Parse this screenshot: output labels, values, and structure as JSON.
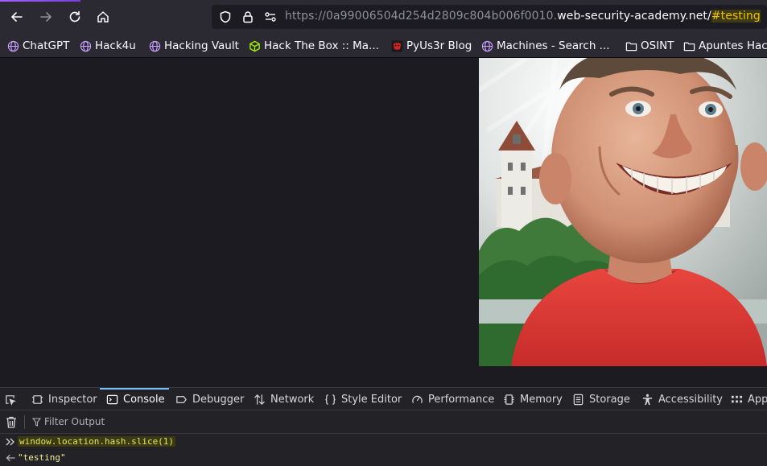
{
  "browser": {
    "url": {
      "prefix": "https://0a99006504d254d2809c804b006f0010.",
      "domain": "web-security-academy.net/",
      "hash": "#testing"
    },
    "icons": [
      "back-arrow-icon",
      "forward-arrow-icon",
      "reload-icon",
      "home-icon",
      "shield-icon",
      "lock-icon",
      "permissions-icon"
    ]
  },
  "bookmarks": [
    {
      "label": "ChatGPT",
      "icon": "globe-icon"
    },
    {
      "label": "Hack4u",
      "icon": "globe-icon"
    },
    {
      "label": "Hacking Vault",
      "icon": "globe-icon"
    },
    {
      "label": "Hack The Box :: Ma...",
      "icon": "cube-icon"
    },
    {
      "label": "PyUs3r Blog",
      "icon": "mask-icon"
    },
    {
      "label": "Machines - Search ...",
      "icon": "globe-icon"
    },
    {
      "label": "OSINT",
      "icon": "folder-icon"
    },
    {
      "label": "Apuntes Hac",
      "icon": "folder-icon"
    }
  ],
  "devtools": {
    "tabs": [
      {
        "label": "Inspector",
        "icon": "inspector-icon"
      },
      {
        "label": "Console",
        "icon": "console-icon",
        "selected": true
      },
      {
        "label": "Debugger",
        "icon": "debugger-icon"
      },
      {
        "label": "Network",
        "icon": "network-icon"
      },
      {
        "label": "Style Editor",
        "icon": "braces-icon"
      },
      {
        "label": "Performance",
        "icon": "gauge-icon"
      },
      {
        "label": "Memory",
        "icon": "chip-icon"
      },
      {
        "label": "Storage",
        "icon": "storage-icon"
      },
      {
        "label": "Accessibility",
        "icon": "accessibility-icon"
      },
      {
        "label": "App",
        "icon": "grid-icon"
      }
    ],
    "filter_placeholder": "Filter Output",
    "console": {
      "input": "window.location.hash.slice(1)",
      "output": "\"testing\""
    }
  },
  "colors": {
    "toolbar_bg": "#2b2a33",
    "page_bg": "#1c1b22",
    "devtools_bg": "#232327",
    "accent": "#75bfff",
    "hash_highlight": "#f0c000"
  }
}
